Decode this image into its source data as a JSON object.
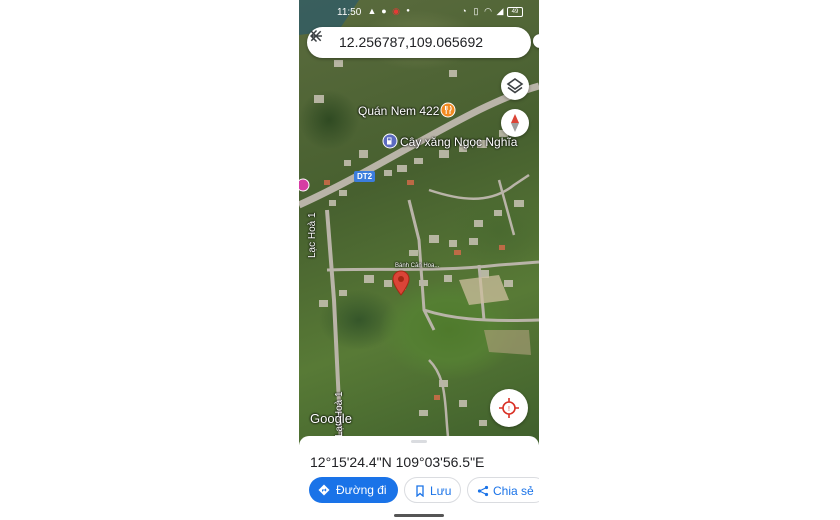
{
  "status_bar": {
    "time": "11:50",
    "left_icons": [
      "warning-icon",
      "chat-icon",
      "record-icon",
      "dot-icon"
    ],
    "right_icons": [
      "alarm-icon",
      "vibrate-icon",
      "wifi-icon",
      "signal-icon",
      "battery-icon"
    ]
  },
  "search": {
    "query": "12.256787,109.065692",
    "back_icon": "arrow-back-icon",
    "close_icon": "close-icon"
  },
  "map": {
    "poi_labels": [
      "Quán Nem 422",
      "Cây xăng Ngọc Nghĩa",
      "Bánh Căn Hoa..."
    ],
    "road_labels": [
      "Lạc Hoà 1",
      "Lạc Hoà 1"
    ],
    "route_badge": "DT2",
    "attribution": "Google",
    "colors": {
      "pin_red": "#db4437",
      "restaurant_orange": "#f28b22",
      "gas_blue": "#5c6bc0",
      "accent_blue": "#1a73e8",
      "road_gray": "#b9b4a8"
    }
  },
  "bottom_sheet": {
    "coordinates": "12°15'24.4\"N 109°03'56.5\"E",
    "actions": {
      "directions": "Đường đi",
      "save": "Lưu",
      "share": "Chia sẻ"
    }
  }
}
